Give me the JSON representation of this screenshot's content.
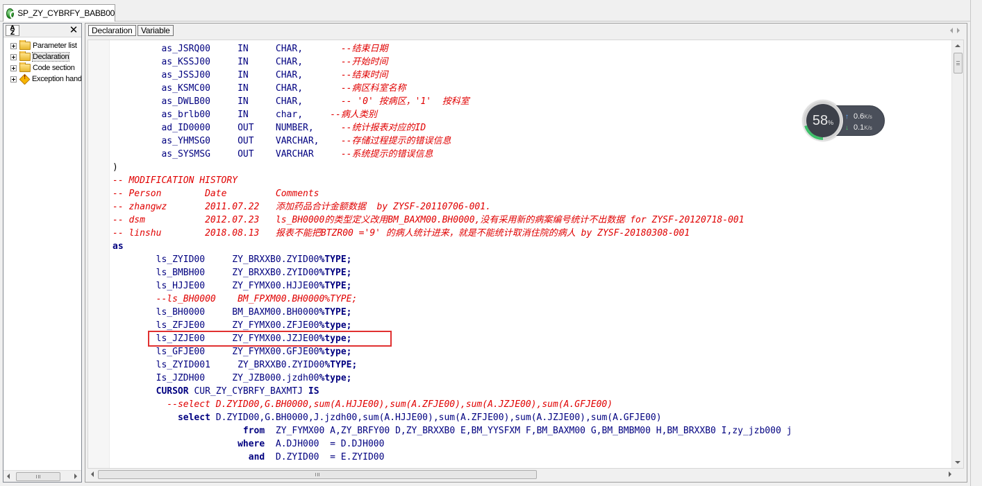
{
  "document_tab": {
    "title": "SP_ZY_CYBRFY_BABB00"
  },
  "left_panel": {
    "sort_label": "A\nZ",
    "close_label": "✕",
    "tree": [
      {
        "label": "Parameter list"
      },
      {
        "label": "Declaration"
      },
      {
        "label": "Code section"
      },
      {
        "label": "Exception handler"
      }
    ]
  },
  "editor_tabs": {
    "declaration": "Declaration",
    "variable": "Variable"
  },
  "code_lines": [
    {
      "segs": [
        {
          "t": "as_JSRQ00",
          "col": 9
        },
        {
          "t": "IN",
          "col": 23
        },
        {
          "t": "CHAR,",
          "col": 30
        },
        {
          "t": "--结束日期",
          "col": 42,
          "c": true
        }
      ]
    },
    {
      "segs": [
        {
          "t": "as_KSSJ00",
          "col": 9
        },
        {
          "t": "IN",
          "col": 23
        },
        {
          "t": "CHAR,",
          "col": 30
        },
        {
          "t": "--开始时间",
          "col": 42,
          "c": true
        }
      ]
    },
    {
      "segs": [
        {
          "t": "as_JSSJ00",
          "col": 9
        },
        {
          "t": "IN",
          "col": 23
        },
        {
          "t": "CHAR,",
          "col": 30
        },
        {
          "t": "--结束时间",
          "col": 42,
          "c": true
        }
      ]
    },
    {
      "segs": [
        {
          "t": "as_KSMC00",
          "col": 9
        },
        {
          "t": "IN",
          "col": 23
        },
        {
          "t": "CHAR,",
          "col": 30
        },
        {
          "t": "--病区科室名称",
          "col": 42,
          "c": true
        }
      ]
    },
    {
      "segs": [
        {
          "t": "as_DWLB00",
          "col": 9
        },
        {
          "t": "IN",
          "col": 23
        },
        {
          "t": "CHAR,",
          "col": 30
        },
        {
          "t": "-- '0' 按病区，'1'  按科室",
          "col": 42,
          "c": true
        }
      ]
    },
    {
      "segs": [
        {
          "t": "as_brlb00",
          "col": 9
        },
        {
          "t": "IN",
          "col": 23
        },
        {
          "t": "char,",
          "col": 30
        },
        {
          "t": "--病人类别",
          "col": 40,
          "c": true
        }
      ]
    },
    {
      "segs": [
        {
          "t": "ad_ID0000",
          "col": 9
        },
        {
          "t": "OUT",
          "col": 23
        },
        {
          "t": "NUMBER,",
          "col": 30
        },
        {
          "t": "--统计报表对应的ID",
          "col": 42,
          "c": true
        }
      ]
    },
    {
      "segs": [
        {
          "t": "as_YHMSG0",
          "col": 9
        },
        {
          "t": "OUT",
          "col": 23
        },
        {
          "t": "VARCHAR,",
          "col": 30
        },
        {
          "t": "--存储过程提示的错误信息",
          "col": 42,
          "c": true
        }
      ]
    },
    {
      "segs": [
        {
          "t": "as_SYSMSG",
          "col": 9
        },
        {
          "t": "OUT",
          "col": 23
        },
        {
          "t": "VARCHAR",
          "col": 30
        },
        {
          "t": "--系统提示的错误信息",
          "col": 42,
          "c": true
        }
      ]
    },
    {
      "segs": [
        {
          "t": ")",
          "col": 0,
          "p": true
        }
      ]
    },
    {
      "segs": [
        {
          "t": "-- MODIFICATION HISTORY",
          "col": 0,
          "c": true
        }
      ]
    },
    {
      "segs": [
        {
          "t": "-- Person",
          "col": 0,
          "c": true
        },
        {
          "t": "Date",
          "col": 17,
          "c": true
        },
        {
          "t": "Comments",
          "col": 30,
          "c": true
        }
      ]
    },
    {
      "segs": [
        {
          "t": "-- zhangwz",
          "col": 0,
          "c": true
        },
        {
          "t": "2011.07.22",
          "col": 17,
          "c": true
        },
        {
          "t": "添加药品合计金额数据  by ZYSF-20110706-001.",
          "col": 30,
          "c": true
        }
      ]
    },
    {
      "segs": [
        {
          "t": "-- dsm",
          "col": 0,
          "c": true
        },
        {
          "t": "2012.07.23",
          "col": 17,
          "c": true
        },
        {
          "t": "ls_BH0000的类型定义改用BM_BAXM00.BH0000,没有采用新的病案编号统计不出数据 for ZYSF-20120718-001",
          "col": 30,
          "c": true
        }
      ]
    },
    {
      "segs": [
        {
          "t": "-- linshu",
          "col": 0,
          "c": true
        },
        {
          "t": "2018.08.13",
          "col": 17,
          "c": true
        },
        {
          "t": "报表不能把BTZR00 ='9' 的病人统计进来，就是不能统计取消住院的病人 by ZYSF-20180308-001",
          "col": 30,
          "c": true
        }
      ]
    },
    {
      "segs": [
        {
          "t": "as",
          "col": 0,
          "k": true
        }
      ]
    },
    {
      "segs": [
        {
          "t": "ls_ZYID00",
          "col": 8
        },
        {
          "t": "ZY_BRXXB0.ZYID00",
          "col": 22
        },
        {
          "t": "%TYPE;",
          "col": 38,
          "k": true
        }
      ]
    },
    {
      "segs": [
        {
          "t": "ls_BMBH00",
          "col": 8
        },
        {
          "t": "ZY_BRXXB0.ZYID00",
          "col": 22
        },
        {
          "t": "%TYPE;",
          "col": 38,
          "k": true
        }
      ]
    },
    {
      "segs": [
        {
          "t": "ls_HJJE00",
          "col": 8
        },
        {
          "t": "ZY_FYMX00.HJJE00",
          "col": 22
        },
        {
          "t": "%TYPE;",
          "col": 38,
          "k": true
        }
      ]
    },
    {
      "segs": [
        {
          "t": "--ls_BH0000",
          "col": 8,
          "c": true
        },
        {
          "t": "BM_FPXM00.BH0000%TYPE;",
          "col": 23,
          "c": true
        }
      ]
    },
    {
      "segs": [
        {
          "t": "ls_BH0000",
          "col": 8
        },
        {
          "t": "BM_BAXM00.BH0000",
          "col": 22
        },
        {
          "t": "%TYPE;",
          "col": 38,
          "k": true
        }
      ]
    },
    {
      "segs": [
        {
          "t": "ls_ZFJE00",
          "col": 8
        },
        {
          "t": "ZY_FYMX00.ZFJE00",
          "col": 22
        },
        {
          "t": "%type;",
          "col": 38,
          "k": true
        }
      ]
    },
    {
      "segs": [
        {
          "t": "ls_JZJE00",
          "col": 8
        },
        {
          "t": "ZY_FYMX00.JZJE00",
          "col": 22
        },
        {
          "t": "%type;",
          "col": 38,
          "k": true
        }
      ]
    },
    {
      "segs": [
        {
          "t": "ls_GFJE00",
          "col": 8
        },
        {
          "t": "ZY_FYMX00.GFJE00",
          "col": 22
        },
        {
          "t": "%type;",
          "col": 38,
          "k": true
        }
      ]
    },
    {
      "segs": [
        {
          "t": "ls_ZYID001",
          "col": 8
        },
        {
          "t": "ZY_BRXXB0.ZYID00",
          "col": 23
        },
        {
          "t": "%TYPE;",
          "col": 39,
          "k": true
        }
      ]
    },
    {
      "segs": [
        {
          "t": "Is_JZDH00",
          "col": 8
        },
        {
          "t": "ZY_JZB000.jzdh00",
          "col": 22
        },
        {
          "t": "%type;",
          "col": 38,
          "k": true
        }
      ]
    },
    {
      "segs": [
        {
          "t": "CURSOR",
          "col": 8,
          "k": true
        },
        {
          "t": "CUR_ZY_CYBRFY_BAXMTJ",
          "col": 15
        },
        {
          "t": "IS",
          "col": 36,
          "k": true
        }
      ]
    },
    {
      "segs": [
        {
          "t": "--select D.ZYID00,G.BH0000,sum(A.HJJE00),sum(A.ZFJE00),sum(A.JZJE00),sum(A.GFJE00)",
          "col": 10,
          "c": true
        }
      ]
    },
    {
      "segs": [
        {
          "t": "select",
          "col": 12,
          "k": true
        },
        {
          "t": "D.ZYID00,G.BH0000,J.jzdh00,sum(A.HJJE00),sum(A.ZFJE00),sum(A.JZJE00),sum(A.GFJE00)",
          "col": 19
        }
      ]
    },
    {
      "segs": [
        {
          "t": "from",
          "col": 24,
          "k": true
        },
        {
          "t": "ZY_FYMX00 A,ZY_BRFY00 D,ZY_BRXXB0 E,BM_YYSFXM F,BM_BAXM00 G,BM_BMBM00 H,BM_BRXXB0 I,zy_jzb000 j",
          "col": 30
        }
      ]
    },
    {
      "segs": [
        {
          "t": "where",
          "col": 23,
          "k": true
        },
        {
          "t": "A.DJH000  = D.DJH000",
          "col": 30
        }
      ]
    },
    {
      "segs": [
        {
          "t": "and",
          "col": 25,
          "k": true
        },
        {
          "t": "D.ZYID00  = E.ZYID00",
          "col": 30
        }
      ]
    }
  ],
  "net_monitor": {
    "percent": "58",
    "percent_sign": "%",
    "percent_value": 0.58,
    "upload_value": "0.6",
    "download_value": "0.1",
    "unit": "K/s",
    "upload_arrow": "↑",
    "download_arrow": "↓",
    "ring_color": "#3ec06a",
    "up_color": "#5aa8ff",
    "down_color": "#4cc46a"
  }
}
